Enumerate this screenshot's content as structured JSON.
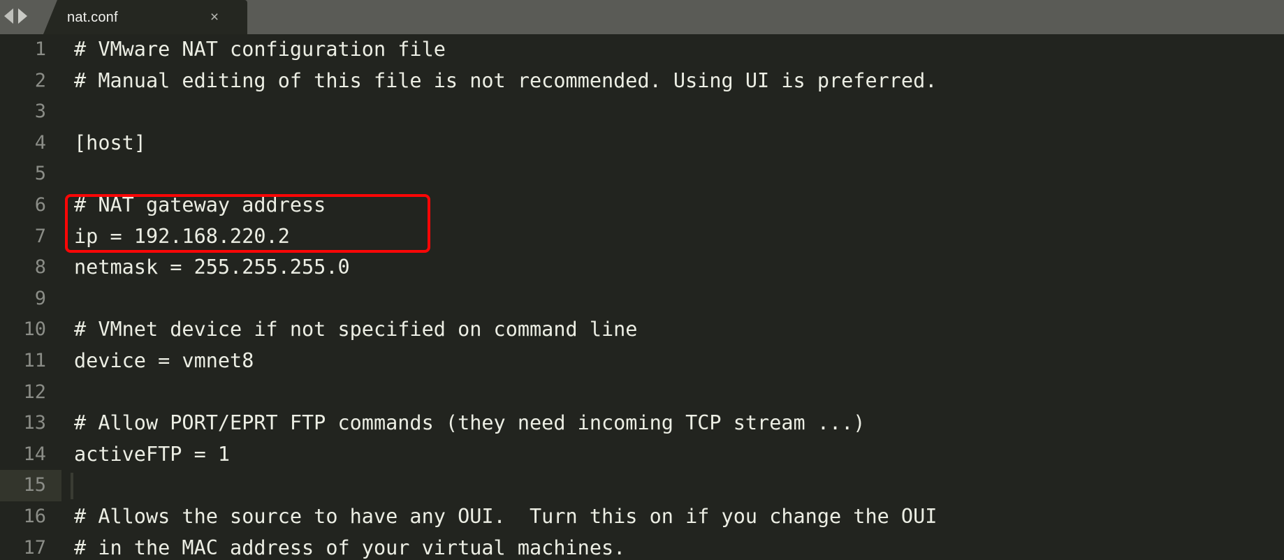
{
  "window": {
    "title": "nat.conf",
    "editor_bg": "#22241f",
    "tabbar_bg": "#5a5b56",
    "text_color": "#eceee4",
    "linenumber_color": "#8b8d87",
    "annotation_color": "#fc0606"
  },
  "nav": {
    "back_icon": "triangle-left-icon",
    "forward_icon": "triangle-right-icon"
  },
  "tab": {
    "label": "nat.conf",
    "close_label": "×"
  },
  "editor": {
    "active_line": 15,
    "lines": [
      {
        "n": "1",
        "text": "# VMware NAT configuration file"
      },
      {
        "n": "2",
        "text": "# Manual editing of this file is not recommended. Using UI is preferred."
      },
      {
        "n": "3",
        "text": ""
      },
      {
        "n": "4",
        "text": "[host]"
      },
      {
        "n": "5",
        "text": ""
      },
      {
        "n": "6",
        "text": "# NAT gateway address"
      },
      {
        "n": "7",
        "text": "ip = 192.168.220.2"
      },
      {
        "n": "8",
        "text": "netmask = 255.255.255.0"
      },
      {
        "n": "9",
        "text": ""
      },
      {
        "n": "10",
        "text": "# VMnet device if not specified on command line"
      },
      {
        "n": "11",
        "text": "device = vmnet8"
      },
      {
        "n": "12",
        "text": ""
      },
      {
        "n": "13",
        "text": "# Allow PORT/EPRT FTP commands (they need incoming TCP stream ...)"
      },
      {
        "n": "14",
        "text": "activeFTP = 1"
      },
      {
        "n": "15",
        "text": ""
      },
      {
        "n": "16",
        "text": "# Allows the source to have any OUI.  Turn this on if you change the OUI"
      },
      {
        "n": "17",
        "text": "# in the MAC address of your virtual machines."
      }
    ]
  },
  "annotation": {
    "kind": "red-rectangle-highlight",
    "covers_lines": "6-7",
    "highlighted_text": "# NAT gateway address\nip = 192.168.220.2"
  }
}
